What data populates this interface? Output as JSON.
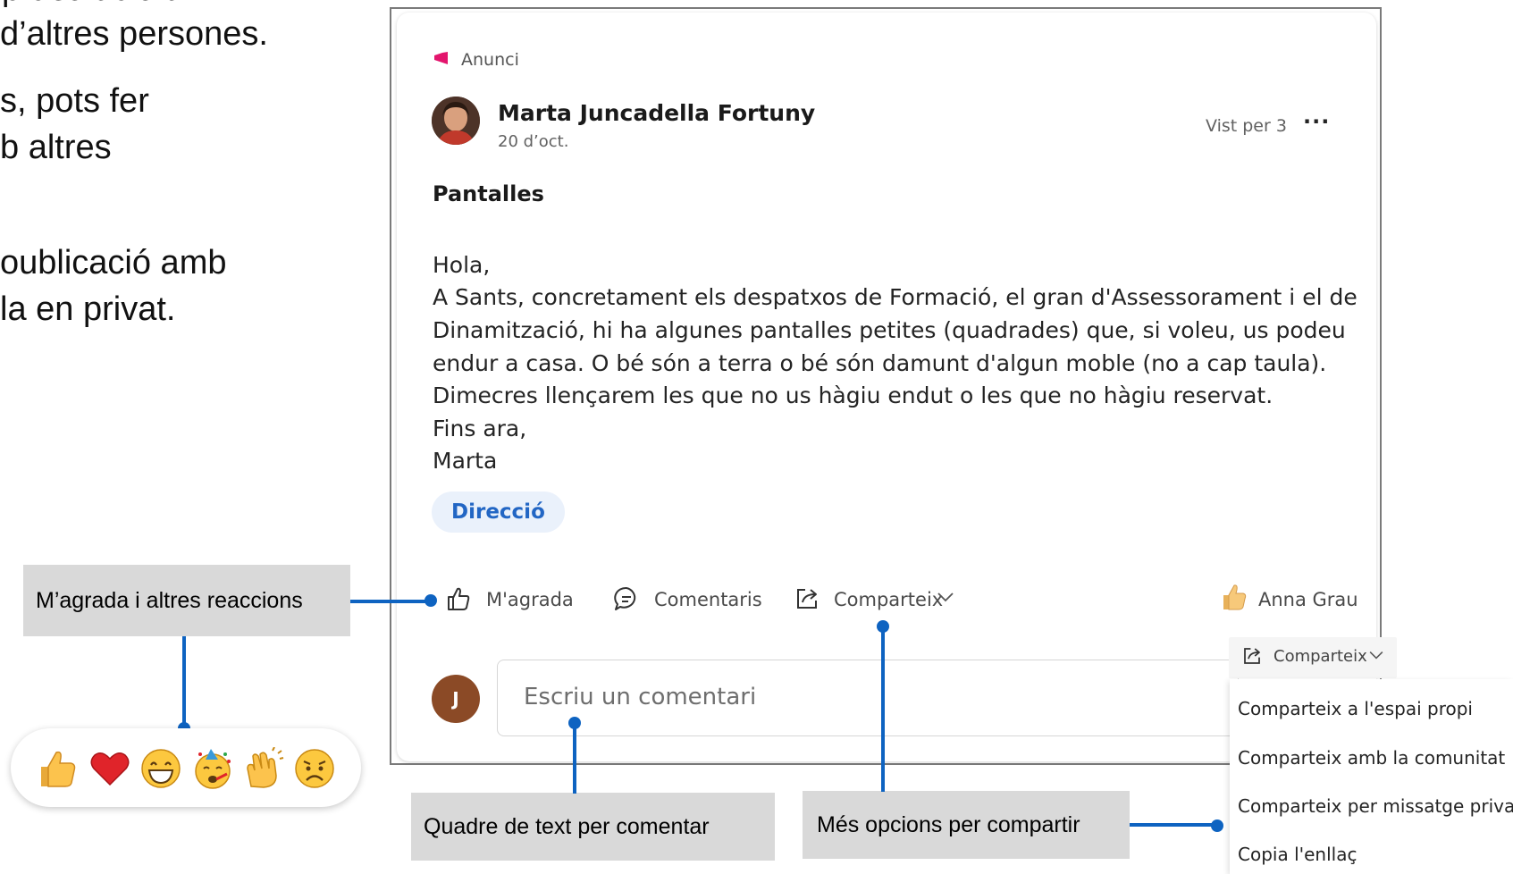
{
  "background_text": {
    "lines": [
      "d’altres persones.",
      "s, pots fer",
      "b altres",
      "oublicació amb",
      "la en privat."
    ]
  },
  "post": {
    "type_label": "Anunci",
    "author": "Marta Juncadella Fortuny",
    "date": "20 d’oct.",
    "seen_by": "Vist per 3",
    "more_label": "···",
    "title": "Pantalles",
    "body_lines": [
      "Hola,",
      "A Sants, concretament els despatxos de Formació, el gran d'Assessorament i el de",
      "Dinamització, hi ha algunes pantalles petites (quadrades) que, si voleu, us podeu",
      "endur a casa. O bé són a terra o bé són damunt d'algun moble (no a cap taula).",
      "Dimecres llençarem les que no us hàgiu endut o les que no hàgiu reservat.",
      "Fins ara,",
      "Marta"
    ],
    "tag": "Direcció",
    "actions": {
      "like": "M'agrada",
      "comments": "Comentaris",
      "share": "Comparteix",
      "reacted_by": "Anna Grau"
    },
    "comment": {
      "avatar_initial": "J",
      "placeholder": "Escriu un comentari"
    }
  },
  "share_menu": {
    "button_label": "Comparteix",
    "items": [
      "Comparteix a l'espai propi",
      "Comparteix amb la comunitat",
      "Comparteix per missatge privat",
      "Copia l'enllaç"
    ]
  },
  "callouts": {
    "reactions": "M’agrada i altres reaccions",
    "comment_box": "Quadre de text per comentar",
    "share_options": "Més opcions per compartir"
  },
  "reactions": [
    "thumbs-up",
    "heart",
    "laugh",
    "celebrate",
    "clap",
    "sad"
  ],
  "colors": {
    "accent": "#0e63c1",
    "announcement": "#e3156d",
    "tag_text": "#2266c4",
    "tag_bg": "#eaf1fb",
    "callout_bg": "#d9d9d9",
    "avatar_j": "#8b4a26"
  }
}
